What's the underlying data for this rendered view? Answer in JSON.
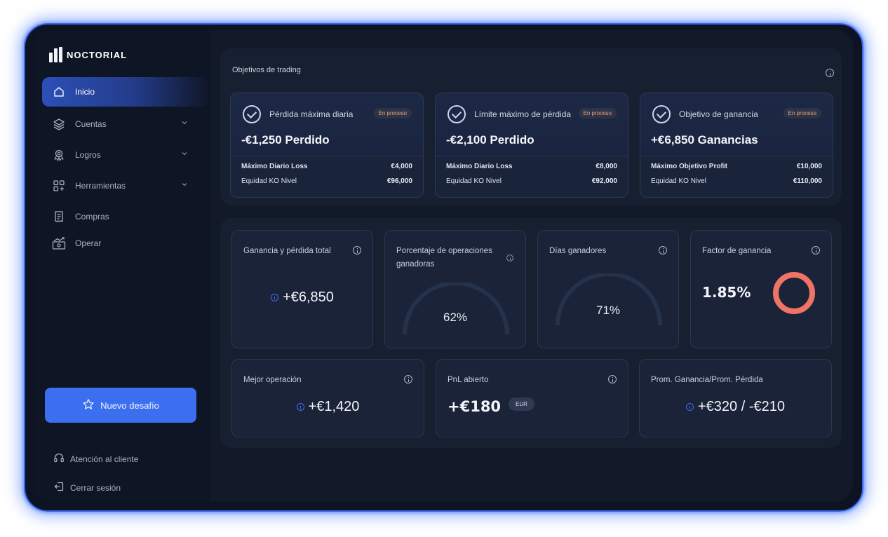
{
  "brand": {
    "name": "NOCTORIAL"
  },
  "sidebar": {
    "items": [
      {
        "label": "Inicio",
        "icon": "home-icon",
        "active": true,
        "expandable": false
      },
      {
        "label": "Cuentas",
        "icon": "layers-icon",
        "active": false,
        "expandable": true
      },
      {
        "label": "Logros",
        "icon": "award-icon",
        "active": false,
        "expandable": true
      },
      {
        "label": "Herramientas",
        "icon": "grid-plus-icon",
        "active": false,
        "expandable": true
      },
      {
        "label": "Compras",
        "icon": "receipt-icon",
        "active": false,
        "expandable": false
      },
      {
        "label": "Operar",
        "icon": "chart-trend-icon",
        "active": false,
        "expandable": false
      }
    ],
    "new_challenge_label": "Nuevo desafío",
    "support_label": "Atención al cliente",
    "logout_label": "Cerrar sesión"
  },
  "objectives": {
    "title": "Objetivos de trading",
    "cards": [
      {
        "title": "Pérdida máxima diaria",
        "status": "En proceso",
        "value": "-€1,250 Perdido",
        "rows": [
          {
            "label": "Máximo Diario Loss",
            "value": "€4,000"
          },
          {
            "label": "Equidad KO Nivel",
            "value": "€96,000"
          }
        ]
      },
      {
        "title": "Límite máximo de pérdida",
        "status": "En proceso",
        "value": "-€2,100 Perdido",
        "rows": [
          {
            "label": "Máximo Diario Loss",
            "value": "€8,000"
          },
          {
            "label": "Equidad KO Nivel",
            "value": "€92,000"
          }
        ]
      },
      {
        "title": "Objetivo de ganancia",
        "status": "En proceso",
        "value": "+€6,850 Ganancias",
        "rows": [
          {
            "label": "Máximo Objetivo Profit",
            "value": "€10,000"
          },
          {
            "label": "Equidad KO Nivel",
            "value": "€110,000"
          }
        ]
      }
    ]
  },
  "stats": {
    "total_pnl": {
      "label": "Ganancia y pérdida total",
      "value": "+€6,850"
    },
    "win_rate": {
      "label": "Porcentaje de operaciones ganadoras",
      "value": "62%",
      "percent": 62
    },
    "winning_days": {
      "label": "Días ganadores",
      "value": "71%",
      "percent": 71
    },
    "profit_factor": {
      "label": "Factor de ganancia",
      "value": "1.85%",
      "ring_color": "#ef7467"
    },
    "best_trade": {
      "label": "Mejor operación",
      "value": "+€1,420"
    },
    "open_pnl": {
      "label": "PnL abierto",
      "value": "+€180",
      "currency": "EUR"
    },
    "avg_ratio": {
      "label": "Prom. Ganancia/Prom. Pérdida",
      "value": "+€320 / -€210"
    }
  },
  "colors": {
    "accent": "#3b6ff0",
    "badge_text": "#e8a07c",
    "background": "#121a29"
  }
}
